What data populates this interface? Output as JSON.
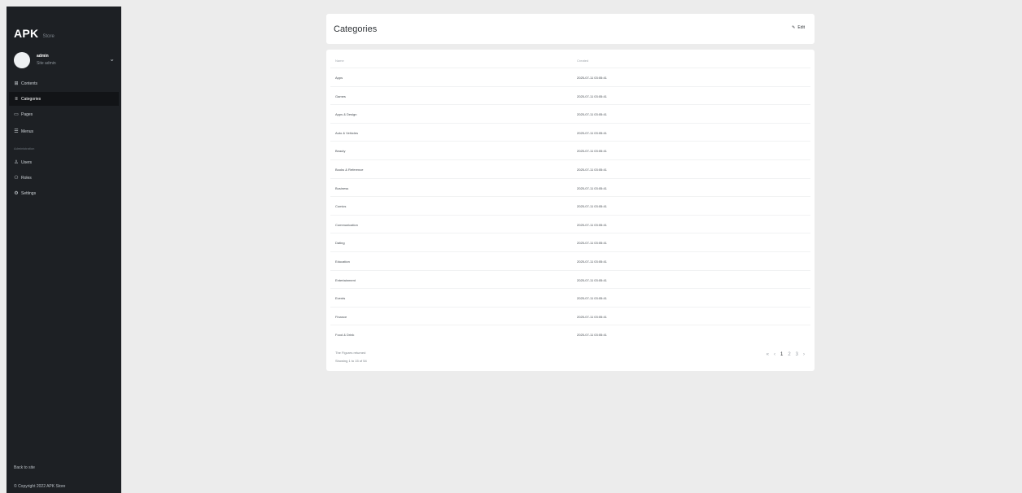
{
  "sidebar": {
    "brand": "APK",
    "brand_sub": "Store",
    "user_name": "admin",
    "user_role": "Site admin",
    "toggle_icon": "chevron-down-icon",
    "nav": [
      {
        "label": "Contents",
        "icon": "grid-icon"
      },
      {
        "label": "Categories",
        "icon": "list-icon"
      },
      {
        "label": "Pages",
        "icon": "pages-icon"
      },
      {
        "label": "Menus",
        "icon": "menu-icon"
      }
    ],
    "section_label": "Administration",
    "nav2": [
      {
        "label": "Users",
        "icon": "user-icon"
      },
      {
        "label": "Roles",
        "icon": "roles-icon"
      },
      {
        "label": "Settings",
        "icon": "gear-icon"
      }
    ],
    "back_label": "Back to site",
    "copyright": "© Copyright 2022 APK Store"
  },
  "header": {
    "title": "Categories",
    "edit_label": "Edit"
  },
  "table": {
    "col_name": "Name",
    "col_created": "Created",
    "rows": [
      {
        "name": "Apps",
        "created": "2025-07-11 03:05:41"
      },
      {
        "name": "Games",
        "created": "2025-07-11 03:05:41"
      },
      {
        "name": "Apps & Design",
        "created": "2025-07-11 03:05:41"
      },
      {
        "name": "Auto & Vehicles",
        "created": "2025-07-11 03:05:41"
      },
      {
        "name": "Beauty",
        "created": "2025-07-11 03:05:41"
      },
      {
        "name": "Books & Reference",
        "created": "2025-07-11 03:05:41"
      },
      {
        "name": "Business",
        "created": "2025-07-11 03:05:41"
      },
      {
        "name": "Comics",
        "created": "2025-07-11 03:05:41"
      },
      {
        "name": "Communication",
        "created": "2025-07-11 03:05:41"
      },
      {
        "name": "Dating",
        "created": "2025-07-11 03:05:41"
      },
      {
        "name": "Education",
        "created": "2025-07-11 03:05:41"
      },
      {
        "name": "Entertainment",
        "created": "2025-07-11 03:05:41"
      },
      {
        "name": "Events",
        "created": "2025-07-11 03:05:41"
      },
      {
        "name": "Finance",
        "created": "2025-07-11 03:05:41"
      },
      {
        "name": "Food & Drink",
        "created": "2025-07-11 03:05:41"
      }
    ],
    "footer_line1": "The Figures returned",
    "footer_line2": "Showing 1 to 15 of 54",
    "pagination": [
      "«",
      "‹",
      "1",
      "2",
      "3",
      "›"
    ]
  }
}
